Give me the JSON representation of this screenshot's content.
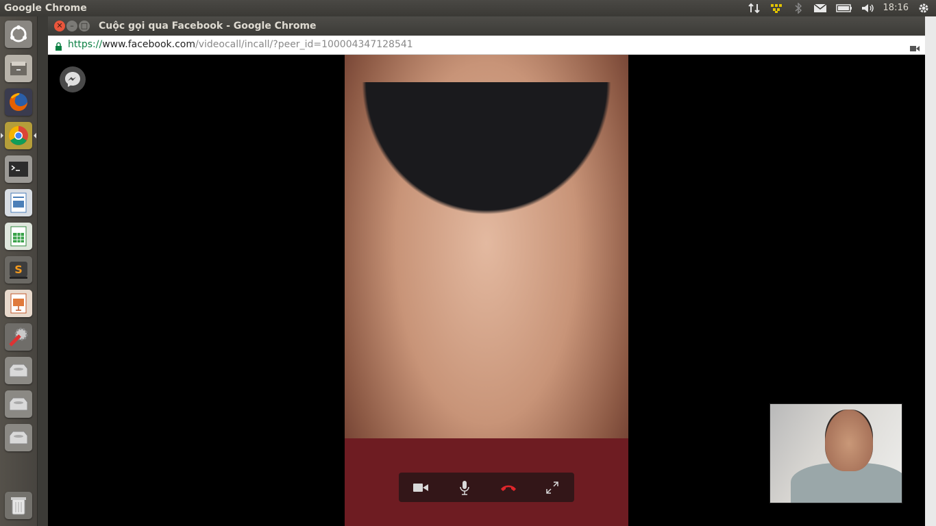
{
  "top_panel": {
    "app_name": "Google Chrome",
    "clock": "18:16",
    "indicators": [
      "network-transfer-icon",
      "updates-icon",
      "bluetooth-icon",
      "mail-icon",
      "battery-icon",
      "volume-icon",
      "settings-gear-icon"
    ]
  },
  "launcher": {
    "items": [
      "dash-home",
      "files",
      "firefox",
      "chrome",
      "terminal",
      "writer",
      "calc",
      "sublime-text",
      "impress",
      "system-settings",
      "drive-1",
      "drive-2",
      "drive-3",
      "trash"
    ]
  },
  "window": {
    "title": "Cuộc gọi qua Facebook - Google Chrome",
    "url": {
      "scheme": "https://",
      "host": "www.facebook.com",
      "path": "/videocall/incall/?peer_id=100004347128541"
    }
  },
  "call": {
    "controls": [
      "video-camera",
      "microphone",
      "end-call",
      "fullscreen"
    ]
  },
  "colors": {
    "end_call": "#e0262b",
    "url_secure": "#0b8043"
  }
}
